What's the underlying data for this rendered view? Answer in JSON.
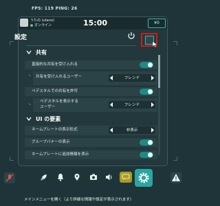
{
  "hud": {
    "fps_ping": "FPS: 119   PING: 26"
  },
  "topbar": {
    "username": "うたの (utano)",
    "status": "オンライン",
    "time": "15:00",
    "wallet": "¥0"
  },
  "settings": {
    "title": "設定",
    "sections": [
      {
        "title": "共有",
        "rows": [
          {
            "label": "直接的な共有を受け入れる",
            "type": "toggle",
            "value": true
          },
          {
            "label": "共有を受け入れるユーザー",
            "type": "select",
            "value": "フレンド",
            "multiline": true
          },
          {
            "label": "ペデスタルでの共有を許可",
            "type": "toggle",
            "value": true
          },
          {
            "label_line1": "ペデスタルを表示する",
            "label_line2": "ユーザー",
            "type": "select",
            "value": "フレンド"
          }
        ]
      },
      {
        "title": "UI の要素",
        "rows": [
          {
            "label": "ネームプレートの表示形式",
            "type": "select",
            "value": "非表示"
          },
          {
            "label": "グループバナーの表示",
            "type": "toggle",
            "value": true
          },
          {
            "label": "ネームプレートに追加情報を表示",
            "type": "toggle",
            "value": true
          }
        ]
      }
    ]
  },
  "dock": {
    "icons": [
      "mic-muted-icon",
      "rocket-icon",
      "bell-icon",
      "map-pin-icon",
      "camera-icon",
      "speaker-icon",
      "chat-icon",
      "gear-icon",
      "warning-icon"
    ]
  },
  "hint": "メインメニューを開く（より詳細な情報や設定が表示されます）",
  "colors": {
    "accent": "#2aa6a2",
    "highlight": "#d21a1a",
    "chat": "#a89c2a"
  }
}
